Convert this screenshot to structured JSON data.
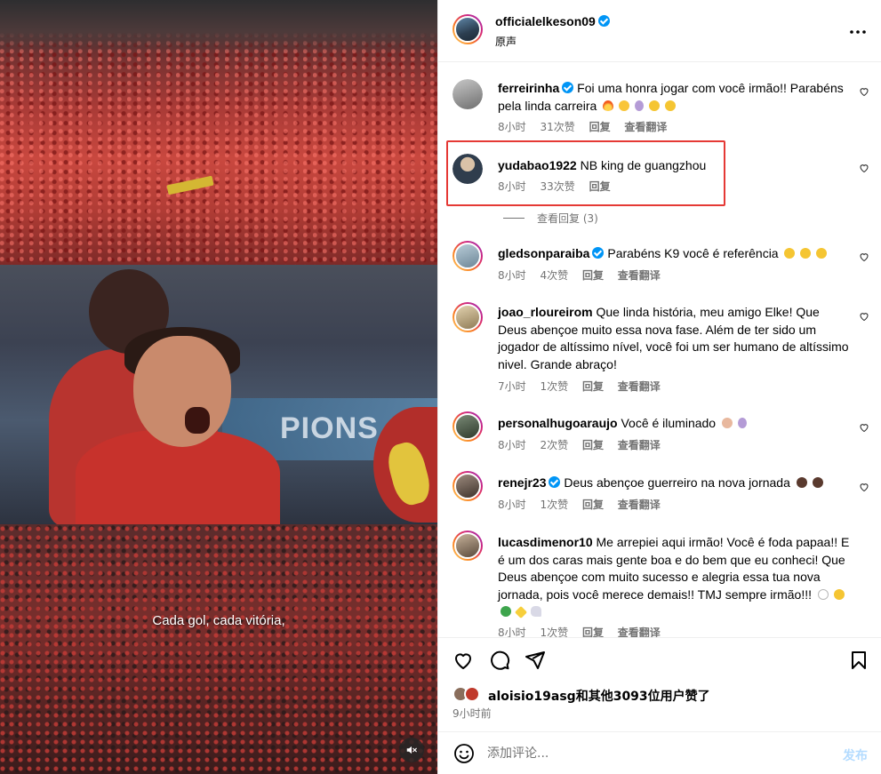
{
  "video": {
    "caption": "Cada gol, cada vitória,",
    "mute_icon": "speaker-muted-icon",
    "banner_text": "PIONS"
  },
  "post": {
    "author": "officialelkeson09",
    "audio": "原声",
    "more_icon": "more-options-icon"
  },
  "comments": [
    {
      "user": "ferreirinha",
      "verified": true,
      "text": "Foi uma honra jogar com você irmão!! Parabéns pela linda carreira",
      "emojis": [
        "fire",
        "raised-hands",
        "pray",
        "clap",
        "clap"
      ],
      "time": "8小时",
      "likes": "31次赞",
      "reply": "回复",
      "translate": "查看翻译",
      "avatar_color": "#8a8a8a"
    },
    {
      "user": "yudabao1922",
      "verified": false,
      "text": "NB king de guangzhou",
      "emojis": [],
      "time": "8小时",
      "likes": "33次赞",
      "reply": "回复",
      "translate": "",
      "avatar_color": "#3c4f63",
      "view_replies": "查看回复 (3)"
    },
    {
      "user": "gledsonparaiba",
      "verified": true,
      "text": "Parabéns K9 você é referência",
      "emojis": [
        "clap",
        "clap",
        "clap"
      ],
      "time": "8小时",
      "likes": "4次赞",
      "reply": "回复",
      "translate": "查看翻译",
      "avatar_color": "#9fb7c6"
    },
    {
      "user": "joao_rloureirom",
      "verified": false,
      "text": "Que linda história, meu amigo Elke! Que Deus abençoe muito essa nova fase. Além de ter sido um jogador de altíssimo nível, você foi um ser humano de altíssimo nivel. Grande abraço!",
      "emojis": [],
      "time": "7小时",
      "likes": "1次赞",
      "reply": "回复",
      "translate": "查看翻译",
      "avatar_color": "#c9b48a"
    },
    {
      "user": "personalhugoaraujo",
      "verified": false,
      "text": "Você é iluminado",
      "emojis": [
        "fist",
        "pray"
      ],
      "time": "8小时",
      "likes": "2次赞",
      "reply": "回复",
      "translate": "查看翻译",
      "avatar_color": "#4d5a4a"
    },
    {
      "user": "renejr23",
      "verified": true,
      "text": "Deus abençoe guerreiro na nova jornada",
      "emojis": [
        "pray-dark",
        "fist-dark"
      ],
      "time": "8小时",
      "likes": "1次赞",
      "reply": "回复",
      "translate": "查看翻译",
      "avatar_color": "#6e5f55"
    },
    {
      "user": "lucasdimenor10",
      "verified": false,
      "text": "Me arrepiei aqui irmão! Você é foda papaa!! E é um dos caras mais gente boa e do bem que eu conheci! Que Deus abençoe com muito sucesso e alegria essa tua nova jornada, pois você merece demais!! TMJ sempre irmão!!!",
      "emojis": [
        "white-heart",
        "fist",
        "shamrock",
        "sparkles",
        "rocket"
      ],
      "time": "8小时",
      "likes": "1次赞",
      "reply": "回复",
      "translate": "查看翻译",
      "avatar_color": "#7a6a5a"
    }
  ],
  "actions": {
    "like_icon": "heart-icon",
    "comment_icon": "comment-icon",
    "share_icon": "share-icon",
    "save_icon": "bookmark-icon"
  },
  "likes": {
    "text": "aloisio19asg和其他3093位用户赞了",
    "time_ago": "9小时前"
  },
  "add_comment": {
    "placeholder": "添加评论...",
    "post_label": "发布",
    "emoji_icon": "smiley-icon"
  },
  "colors": {
    "verified": "#0095f6",
    "highlight_box": "#e53935",
    "post_disabled": "#b3dbff",
    "secondary_text": "#737373"
  }
}
